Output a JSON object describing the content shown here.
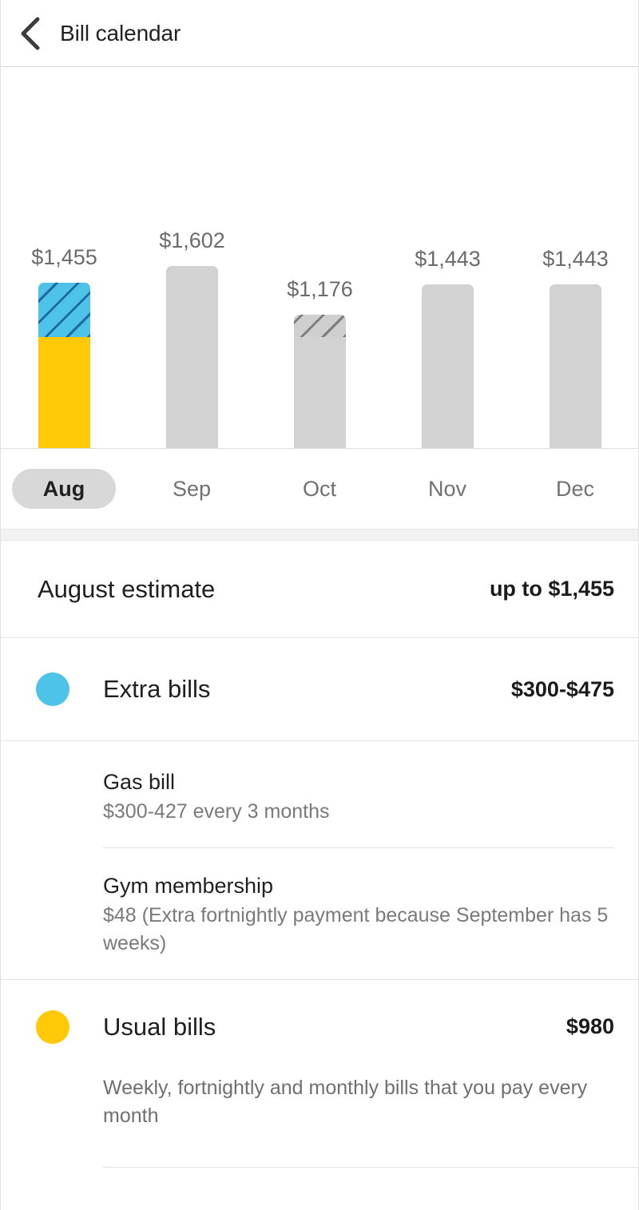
{
  "header": {
    "title": "Bill calendar",
    "back_icon": "chevron-left-icon"
  },
  "chart_data": {
    "type": "bar",
    "title": "",
    "xlabel": "",
    "ylabel": "",
    "categories": [
      "Aug",
      "Sep",
      "Oct",
      "Nov",
      "Dec"
    ],
    "values": [
      1455,
      1602,
      1176,
      1443,
      1443
    ],
    "value_labels": [
      "$1,455",
      "$1,602",
      "$1,176",
      "$1,443",
      "$1,443"
    ],
    "selected_category": "Aug",
    "grid": false,
    "legend_position": "below-as-list",
    "series": [
      {
        "name": "Usual bills",
        "values": [
          980,
          1602,
          980,
          1443,
          1443
        ]
      },
      {
        "name": "Extra bills",
        "values": [
          475,
          0,
          196,
          0,
          0
        ]
      }
    ],
    "colors": {
      "extra_active": "#4ec3e8",
      "usual_active": "#ffc907",
      "inactive": "#d2d2d2",
      "label": "#6b6b6b"
    }
  },
  "months": [
    {
      "label": "Aug",
      "selected": true
    },
    {
      "label": "Sep",
      "selected": false
    },
    {
      "label": "Oct",
      "selected": false
    },
    {
      "label": "Nov",
      "selected": false
    },
    {
      "label": "Dec",
      "selected": false
    }
  ],
  "estimate": {
    "label": "August estimate",
    "value": "up to $1,455"
  },
  "extra_bills": {
    "title": "Extra bills",
    "amount": "$300-$475",
    "dot_color": "#4ec3e8",
    "items": [
      {
        "name": "Gas bill",
        "detail": "$300-427 every 3 months"
      },
      {
        "name": "Gym membership",
        "detail": "$48 (Extra fortnightly payment because September has 5 weeks)"
      }
    ]
  },
  "usual_bills": {
    "title": "Usual bills",
    "amount": "$980",
    "dot_color": "#ffc907",
    "description": "Weekly, fortnightly and monthly bills that you pay every month"
  }
}
